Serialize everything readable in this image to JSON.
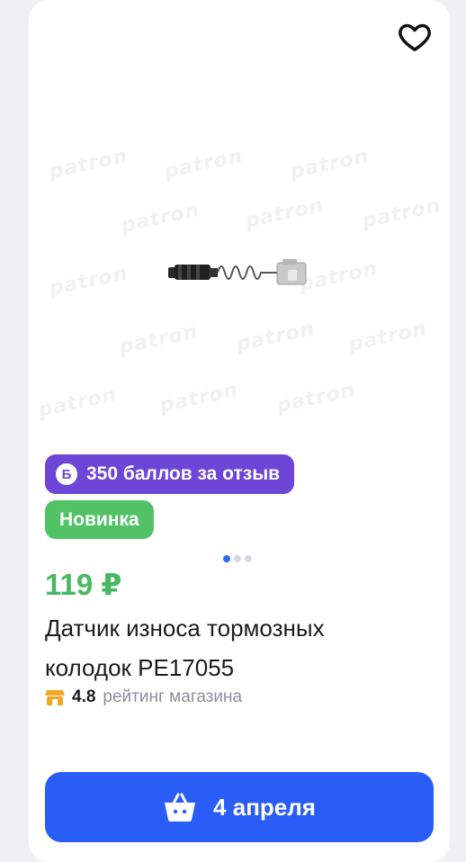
{
  "product": {
    "watermark_text": "patron",
    "points_badge_icon": "Б",
    "points_badge": "350 баллов за отзыв",
    "new_badge": "Новинка",
    "price": "119 ₽",
    "title": "Датчик износа тормозных колодок PE17055",
    "rating_value": "4.8",
    "rating_label": "рейтинг магазина",
    "buy_label": "4 апреля"
  },
  "gallery": {
    "current": 1,
    "total": 3
  },
  "icons": {
    "favorite": "heart-icon",
    "shop": "shop-icon",
    "basket": "basket-icon"
  },
  "colors": {
    "accent": "#2a5df5",
    "price": "#48b962",
    "points": "#6d46d8",
    "new": "#52c267",
    "rating_icon": "#f5a623"
  }
}
